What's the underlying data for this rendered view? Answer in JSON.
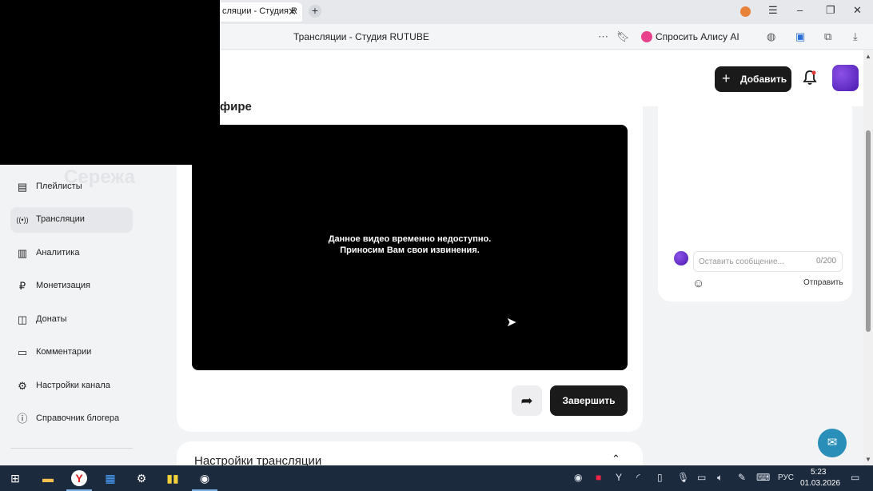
{
  "browser": {
    "tab_title": "сляции - Студия R",
    "tab_close": "✕",
    "new_tab": "+",
    "page_title": "Трансляции - Студия RUTUBE",
    "alice_label": "Спросить Алису AI",
    "icons": [
      "bookmark-icon",
      "more-icon",
      "globe-icon",
      "screen-icon",
      "extensions-icon",
      "download-icon"
    ]
  },
  "header": {
    "add_label": "Добавить",
    "add_icon": "+",
    "bell_icon": "🔔"
  },
  "overlay": {
    "ghost_text": "Сережа"
  },
  "sidebar": {
    "items": [
      {
        "label": "Плейлисты",
        "icon": "▤",
        "active": false
      },
      {
        "label": "Трансляции",
        "icon": "((•))",
        "active": true
      },
      {
        "label": "Аналитика",
        "icon": "▥",
        "active": false
      },
      {
        "label": "Монетизация",
        "icon": "₽",
        "active": false
      },
      {
        "label": "Донаты",
        "icon": "◫",
        "active": false
      },
      {
        "label": "Комментарии",
        "icon": "▭",
        "active": false
      },
      {
        "label": "Настройки канала",
        "icon": "⚙",
        "active": false
      },
      {
        "label": "Справочник блогера",
        "icon": "ⓘ",
        "active": false
      }
    ]
  },
  "main": {
    "card_title": "фире",
    "player_msg_line1": "Данное видео временно недоступно.",
    "player_msg_line2": "Приносим Вам свои извинения.",
    "end_label": "Завершить",
    "share_icon": "➦",
    "settings_title": "Настройки трансляции",
    "settings_chevron": "⌃"
  },
  "chat": {
    "placeholder": "Оставить сообщение...",
    "counter": "0/200",
    "send_label": "Отправить",
    "emoji_icon": "☺"
  },
  "help_icon": "✉",
  "taskbar": {
    "lang": "РУС",
    "time": "5:23",
    "date": "01.03.2026"
  }
}
